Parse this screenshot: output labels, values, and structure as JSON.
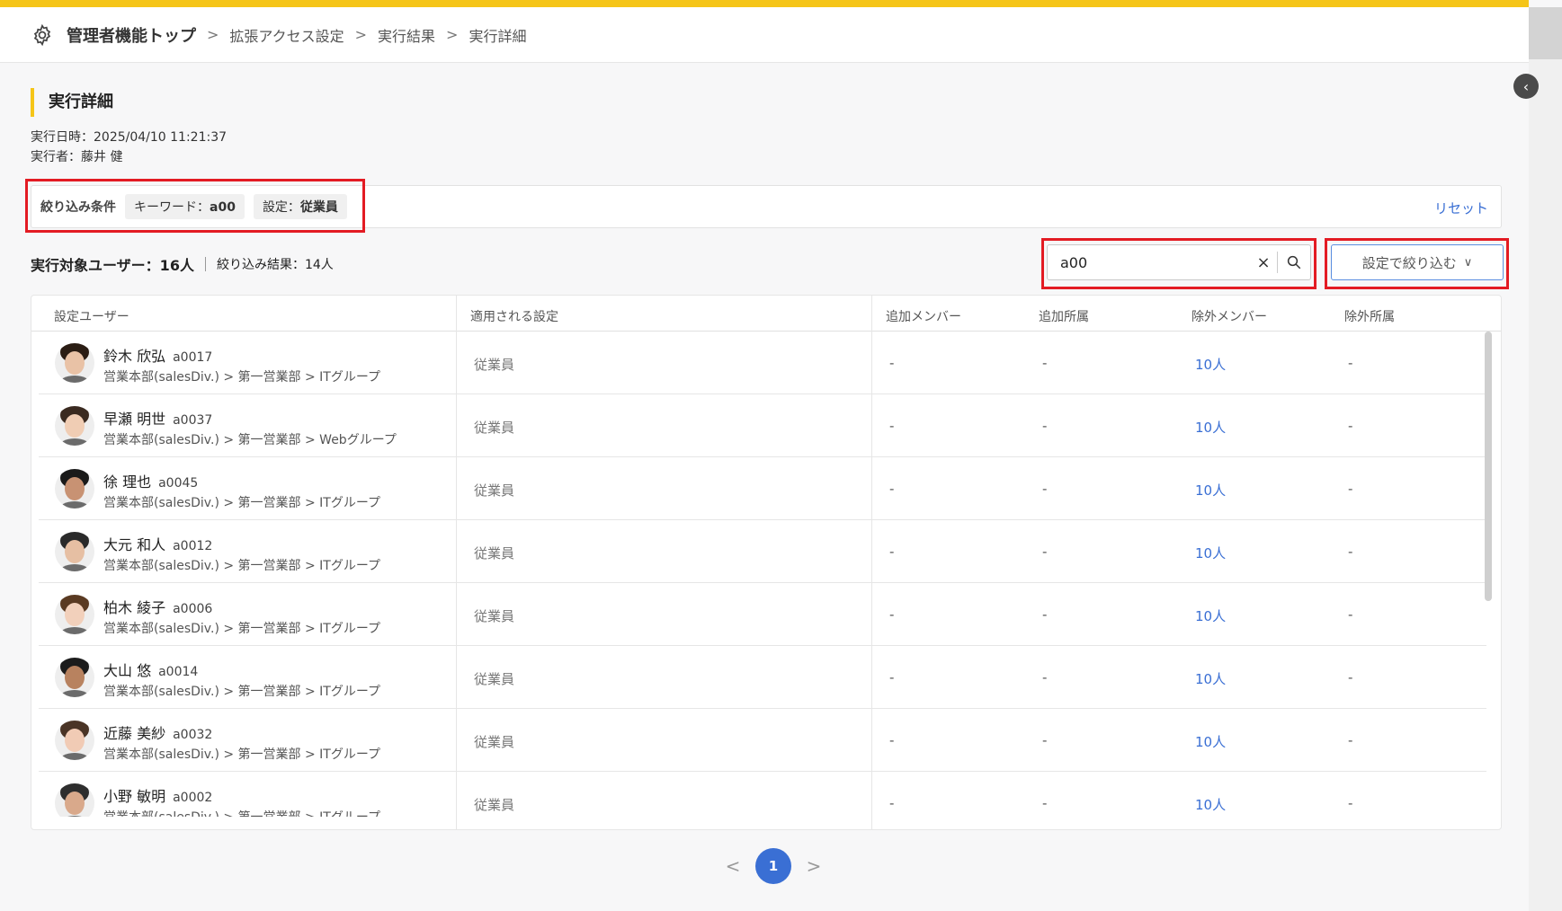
{
  "breadcrumb": {
    "top": "管理者機能トップ",
    "items": [
      "拡張アクセス設定",
      "実行結果",
      "実行詳細"
    ],
    "separator": ">"
  },
  "page": {
    "title": "実行詳細",
    "executed_at": "実行日時：2025/04/10 11:21:37",
    "executor": "実行者：藤井 健"
  },
  "filter": {
    "label": "絞り込み条件",
    "keyword_label": "キーワード：",
    "keyword_value": "a00",
    "setting_label": "設定：",
    "setting_value": "従業員",
    "reset": "リセット"
  },
  "summary": {
    "total": "実行対象ユーザー：16人",
    "result": "絞り込み結果：14人"
  },
  "search": {
    "value": "a00",
    "clear_icon": "×"
  },
  "filter_button": {
    "label": "設定で絞り込む",
    "chevron": "∨"
  },
  "table": {
    "headers": [
      "設定ユーザー",
      "適用される設定",
      "追加メンバー",
      "追加所属",
      "除外メンバー",
      "除外所属"
    ],
    "rows": [
      {
        "name": "鈴木 欣弘",
        "id": "a0017",
        "dept": "営業本部(salesDiv.) > 第一営業部 > ITグループ",
        "setting": "従業員",
        "add_member": "-",
        "add_affil": "-",
        "ex_member": "10人",
        "ex_affil": "-"
      },
      {
        "name": "早瀬 明世",
        "id": "a0037",
        "dept": "営業本部(salesDiv.) > 第一営業部 > Webグループ",
        "setting": "従業員",
        "add_member": "-",
        "add_affil": "-",
        "ex_member": "10人",
        "ex_affil": "-"
      },
      {
        "name": "徐 理也",
        "id": "a0045",
        "dept": "営業本部(salesDiv.) > 第一営業部 > ITグループ",
        "setting": "従業員",
        "add_member": "-",
        "add_affil": "-",
        "ex_member": "10人",
        "ex_affil": "-"
      },
      {
        "name": "大元 和人",
        "id": "a0012",
        "dept": "営業本部(salesDiv.) > 第一営業部 > ITグループ",
        "setting": "従業員",
        "add_member": "-",
        "add_affil": "-",
        "ex_member": "10人",
        "ex_affil": "-"
      },
      {
        "name": "柏木 綾子",
        "id": "a0006",
        "dept": "営業本部(salesDiv.) > 第一営業部 > ITグループ",
        "setting": "従業員",
        "add_member": "-",
        "add_affil": "-",
        "ex_member": "10人",
        "ex_affil": "-"
      },
      {
        "name": "大山 悠",
        "id": "a0014",
        "dept": "営業本部(salesDiv.) > 第一営業部 > ITグループ",
        "setting": "従業員",
        "add_member": "-",
        "add_affil": "-",
        "ex_member": "10人",
        "ex_affil": "-"
      },
      {
        "name": "近藤 美紗",
        "id": "a0032",
        "dept": "営業本部(salesDiv.) > 第一営業部 > ITグループ",
        "setting": "従業員",
        "add_member": "-",
        "add_affil": "-",
        "ex_member": "10人",
        "ex_affil": "-"
      },
      {
        "name": "小野 敏明",
        "id": "a0002",
        "dept": "営業本部(salesDiv.) > 第一営業部 > ITグループ",
        "setting": "従業員",
        "add_member": "-",
        "add_affil": "-",
        "ex_member": "10人",
        "ex_affil": "-"
      }
    ]
  },
  "pagination": {
    "prev": "<",
    "current": "1",
    "next": ">"
  },
  "colors": {
    "accent_yellow": "#f5c518",
    "link_blue": "#3a6fd4",
    "highlight_red": "#e31b23"
  },
  "icons": {
    "header": "gear-icon",
    "collapse": "chevron-left-icon",
    "search": "search-icon",
    "clear": "close-icon"
  }
}
